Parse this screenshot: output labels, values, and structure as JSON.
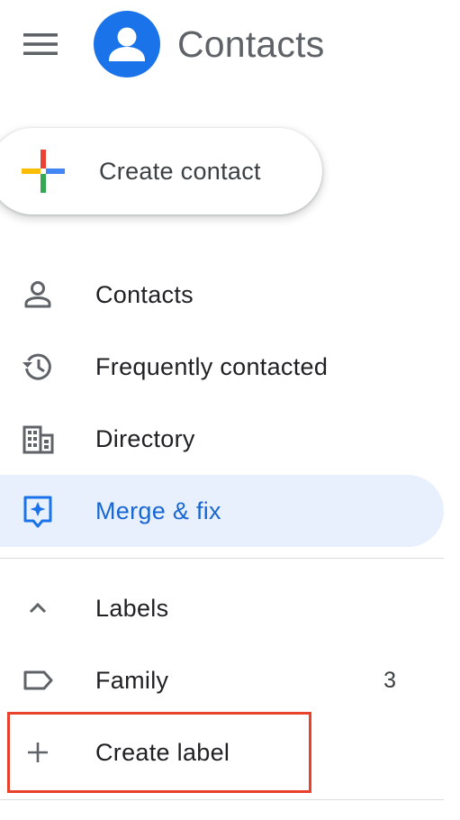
{
  "header": {
    "title": "Contacts",
    "menu_icon": "hamburger-menu-icon",
    "logo_icon": "person-avatar-icon",
    "brand_color": "#1a73e8"
  },
  "fab": {
    "label": "Create contact",
    "icon": "multicolor-plus-icon"
  },
  "nav": {
    "items": [
      {
        "label": "Contacts",
        "icon": "person-icon",
        "active": false
      },
      {
        "label": "Frequently contacted",
        "icon": "history-icon",
        "active": false
      },
      {
        "label": "Directory",
        "icon": "building-icon",
        "active": false
      },
      {
        "label": "Merge & fix",
        "icon": "merge-fix-icon",
        "active": true
      }
    ],
    "active_color": "#1967d2",
    "active_background": "#e8f0fe"
  },
  "labels": {
    "section_label": "Labels",
    "toggle_icon": "chevron-up-icon",
    "items": [
      {
        "label": "Family",
        "count": "3",
        "icon": "label-icon"
      }
    ],
    "create_label": "Create label",
    "create_icon": "plus-icon"
  },
  "annotation": {
    "highlight_color": "#e8412c"
  }
}
